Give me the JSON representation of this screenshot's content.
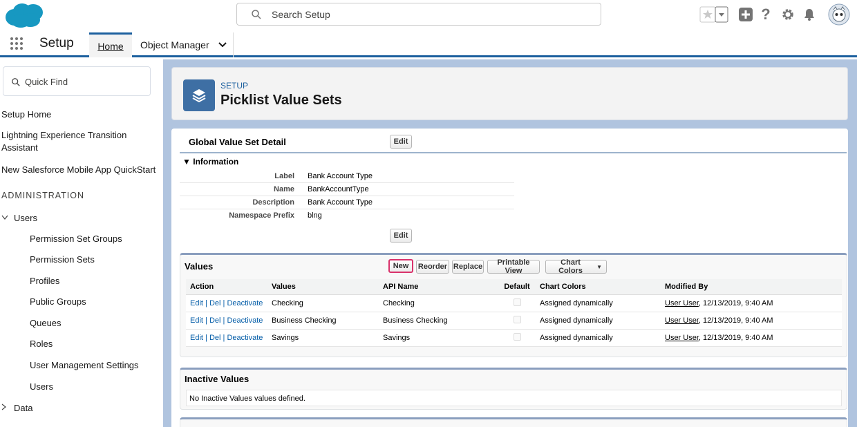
{
  "header": {
    "search_placeholder": "Search Setup",
    "brand_color": "#1798c1"
  },
  "nav": {
    "app_name": "Setup",
    "tabs": [
      {
        "label": "Home"
      },
      {
        "label": "Object Manager"
      }
    ]
  },
  "sidebar": {
    "quickfind_placeholder": "Quick Find",
    "items": [
      "Setup Home",
      "Lightning Experience Transition Assistant",
      "New Salesforce Mobile App QuickStart"
    ],
    "admin_heading": "ADMINISTRATION",
    "users_group": "Users",
    "users_children": [
      "Permission Set Groups",
      "Permission Sets",
      "Profiles",
      "Public Groups",
      "Queues",
      "Roles",
      "User Management Settings",
      "Users"
    ],
    "data_group": "Data"
  },
  "page": {
    "crumb": "SETUP",
    "title": "Picklist Value Sets"
  },
  "detail": {
    "title": "Global Value Set Detail",
    "edit_label": "Edit",
    "info_heading": "Information",
    "fields": [
      {
        "label": "Label",
        "value": "Bank Account Type"
      },
      {
        "label": "Name",
        "value": "BankAccountType"
      },
      {
        "label": "Description",
        "value": "Bank Account Type"
      },
      {
        "label": "Namespace Prefix",
        "value": "blng"
      }
    ]
  },
  "values": {
    "title": "Values",
    "buttons": {
      "new": "New",
      "reorder": "Reorder",
      "replace": "Replace",
      "printable": "Printable View",
      "chart_colors": "Chart Colors"
    },
    "columns": [
      "Action",
      "Values",
      "API Name",
      "Default",
      "Chart Colors",
      "Modified By"
    ],
    "action_edit": "Edit",
    "action_del": "Del",
    "action_deactivate": "Deactivate",
    "rows": [
      {
        "value": "Checking",
        "api": "Checking",
        "color": "Assigned dynamically",
        "user": "User User",
        "date": ", 12/13/2019, 9:40 AM"
      },
      {
        "value": "Business Checking",
        "api": "Business Checking",
        "color": "Assigned dynamically",
        "user": "User User",
        "date": ", 12/13/2019, 9:40 AM"
      },
      {
        "value": "Savings",
        "api": "Savings",
        "color": "Assigned dynamically",
        "user": "User User",
        "date": ", 12/13/2019, 9:40 AM"
      }
    ]
  },
  "inactive": {
    "title": "Inactive Values",
    "empty": "No Inactive Values values defined."
  }
}
